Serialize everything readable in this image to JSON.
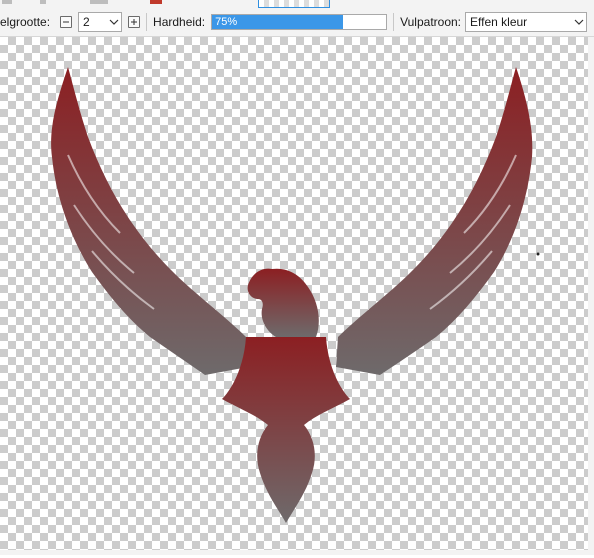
{
  "toolbar": {
    "brush_size_label": "elgrootte:",
    "brush_size_value": "2",
    "hardness_label": "Hardheid:",
    "hardness_text": "75%",
    "hardness_percent": 75,
    "fill_pattern_label": "Vulpatroon:",
    "fill_pattern_value": "Effen kleur"
  },
  "canvas": {
    "gradient_top_color": "#8c1f22",
    "gradient_bottom_color": "#6e6a6b",
    "icon": "eagle-silhouette"
  }
}
